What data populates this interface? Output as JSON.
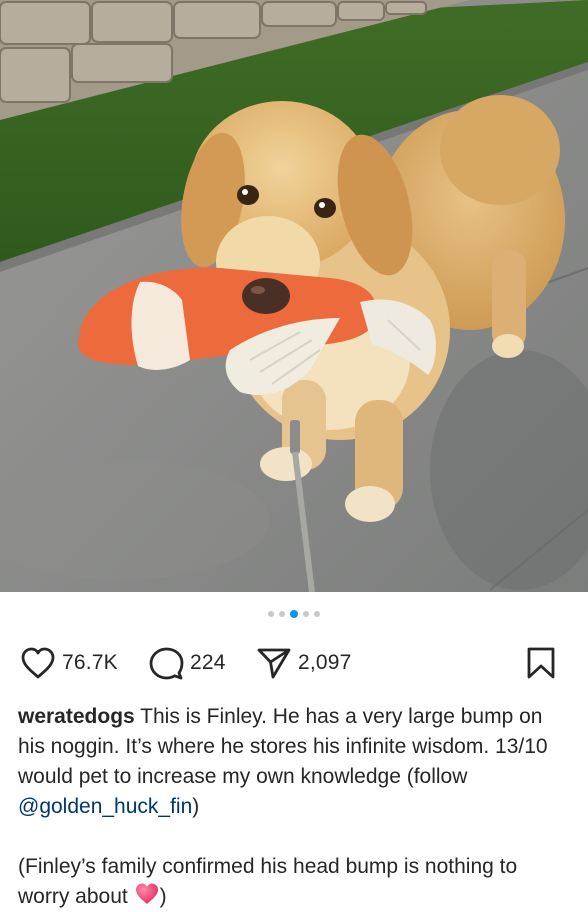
{
  "post": {
    "image": {
      "subject": "golden-retriever-with-fish-toy"
    },
    "carousel": {
      "count": 5,
      "active_index": 2,
      "active_color": "#0095f6",
      "inactive_color": "#c8c8c8"
    },
    "actions": {
      "like_icon": "heart-icon",
      "like_count": "76.7K",
      "comment_icon": "comment-icon",
      "comment_count": "224",
      "share_icon": "paper-plane-icon",
      "share_count": "2,097",
      "save_icon": "bookmark-icon"
    },
    "caption": {
      "username": "weratedogs",
      "text_part1": " This is Finley. He has a very large bump on his noggin. It’s where he stores his infinite wisdom. 13/10 would pet to increase my own knowledge (follow ",
      "mention": "@golden_huck_fin",
      "text_part2": ")",
      "para2_text": "(Finley’s family confirmed his head bump is nothing to worry about ",
      "para2_emoji": "red-heart-emoji",
      "para2_end": ")"
    }
  }
}
